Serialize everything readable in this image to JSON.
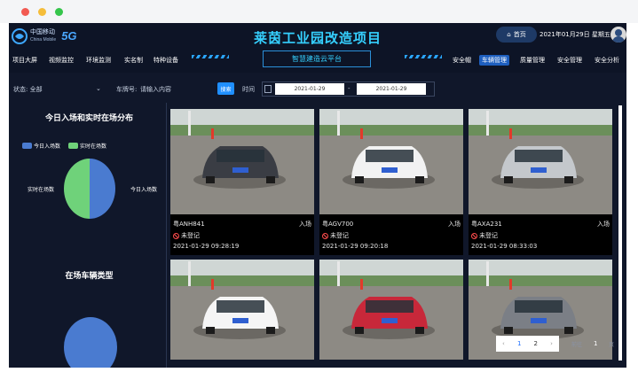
{
  "header": {
    "logo_cn": "中国移动",
    "logo_en": "China Mobile",
    "logo_5g": "5G",
    "title": "莱茵工业园改造项目",
    "subtitle": "智慧建造云平台",
    "home_label": "首页",
    "datetime": "2021年01月29日 星期五"
  },
  "nav_left": [
    "项目大屏",
    "视频监控",
    "环境监测",
    "实名制",
    "特种设备"
  ],
  "nav_right": [
    {
      "label": "安全帽",
      "active": false
    },
    {
      "label": "车辆管理",
      "active": true
    },
    {
      "label": "质量管理",
      "active": false
    },
    {
      "label": "安全管理",
      "active": false
    },
    {
      "label": "安全分析",
      "active": false
    }
  ],
  "filter": {
    "status_label": "状态: 全部",
    "plate_label": "车牌号:",
    "plate_placeholder": "请输入内容",
    "search_label": "搜索",
    "time_label": "时间",
    "date_from": "2021-01-29",
    "date_to": "2021-01-29",
    "separator": "-"
  },
  "left_panel": {
    "chart1_title": "今日入场和实时在场分布",
    "legend": [
      {
        "name": "今日入场数",
        "color": "#4a7bd0"
      },
      {
        "name": "实时在场数",
        "color": "#6fd27a"
      }
    ],
    "pie_label_left": "实时在场数",
    "pie_label_right": "今日入场数",
    "chart2_title": "在场车辆类型"
  },
  "chart_data": [
    {
      "type": "pie",
      "title": "今日入场和实时在场分布",
      "labels": [
        "今日入场数",
        "实时在场数"
      ],
      "values": [
        50,
        50
      ],
      "colors": [
        "#4a7bd0",
        "#6fd27a"
      ],
      "legend_placement": "top-left"
    },
    {
      "type": "pie",
      "title": "在场车辆类型",
      "labels": [],
      "values": [
        100
      ],
      "colors": [
        "#4a7bd0"
      ]
    }
  ],
  "cards": [
    {
      "plate": "粤ANH841",
      "entry": "入场",
      "status": "未登记",
      "time": "2021-01-29 09:28:19",
      "car_color": "#3a3d44"
    },
    {
      "plate": "粤AGV700",
      "entry": "入场",
      "status": "未登记",
      "time": "2021-01-29 09:20:18",
      "car_color": "#f2f2f2"
    },
    {
      "plate": "粤AXA231",
      "entry": "入场",
      "status": "未登记",
      "time": "2021-01-29 08:33:03",
      "car_color": "#c4c8cc"
    },
    {
      "plate": "",
      "entry": "",
      "status": "",
      "time": "",
      "car_color": "#f5f5f5"
    },
    {
      "plate": "",
      "entry": "",
      "status": "",
      "time": "",
      "car_color": "#c8283a"
    },
    {
      "plate": "",
      "entry": "",
      "status": "",
      "time": "",
      "car_color": "#7b7f86"
    }
  ],
  "pagination": {
    "prev": "‹",
    "pages": [
      "1",
      "2"
    ],
    "current": "1",
    "next": "›",
    "goto_label": "前往",
    "goto_value": "1",
    "goto_suffix": "页"
  }
}
